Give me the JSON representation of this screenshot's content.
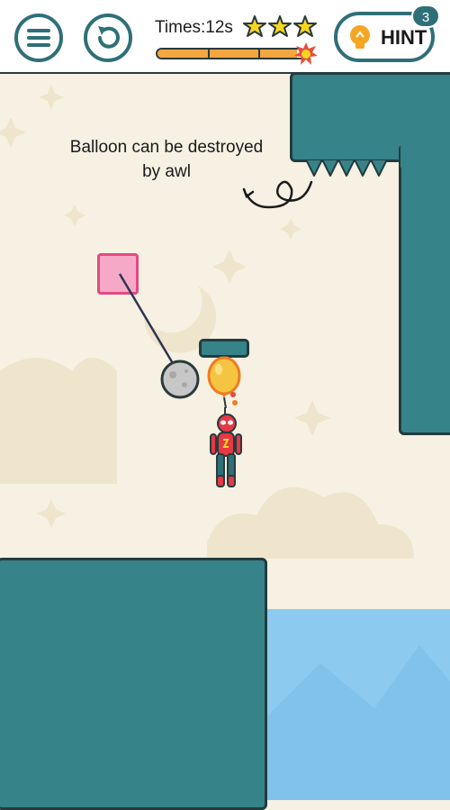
{
  "header": {
    "timer_text": "Times:12s",
    "stars_earned": 3,
    "progress_fraction": 0.95,
    "hint": {
      "label": "HINT",
      "count": "3"
    }
  },
  "scene": {
    "caption_line1": "Balloon can be destroyed",
    "caption_line2": "by awl"
  },
  "colors": {
    "teal": "#36838a",
    "outline": "#243b3e",
    "sky": "#f7f1e3",
    "water": "#8ccbef",
    "pink": "#f6a9c6",
    "balloon": "#f5c542",
    "progress": "#f4a640",
    "star": "#f7d61f"
  },
  "icons": {
    "menu": "menu-icon",
    "restart": "restart-icon",
    "hint": "lightbulb-icon",
    "star": "star-icon"
  }
}
